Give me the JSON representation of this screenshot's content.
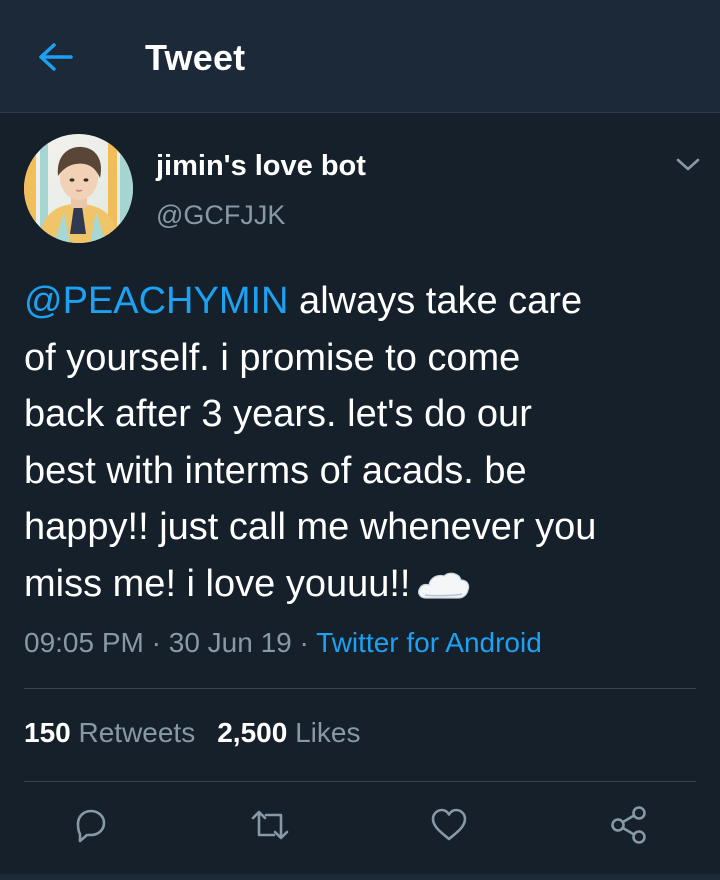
{
  "header": {
    "title": "Tweet",
    "back_icon": "arrow-left-icon",
    "accent": "#1da1f2"
  },
  "tweet": {
    "author": {
      "display_name": "jimin's love bot",
      "handle": "@GCFJJK",
      "avatar": "avatar-photo"
    },
    "text_lines": [
      {
        "mention": "@PEACHYMIN",
        "text": " always take care"
      },
      {
        "text": "of yourself. i promise to come"
      },
      {
        "text": "back after 3 years. let's do our"
      },
      {
        "text": "best with interms of acads. be"
      },
      {
        "text": "happy!! just call me whenever you"
      },
      {
        "text": "miss me! i love youuu!!",
        "emoji": "cloud-icon"
      }
    ],
    "meta": {
      "time": "09:05 PM",
      "separator": " · ",
      "date": "30 Jun 19",
      "source": "Twitter for Android"
    },
    "stats": {
      "retweets_count": "150",
      "retweets_label": " Retweets",
      "likes_count": "2,500",
      "likes_label": " Likes"
    },
    "actions": [
      "reply-icon",
      "retweet-icon",
      "like-icon",
      "share-icon"
    ]
  },
  "colors": {
    "background": "#15202b",
    "header_background": "#1c2938",
    "secondary_text": "#8899a6",
    "link": "#1da1f2",
    "divider": "#38444d"
  }
}
